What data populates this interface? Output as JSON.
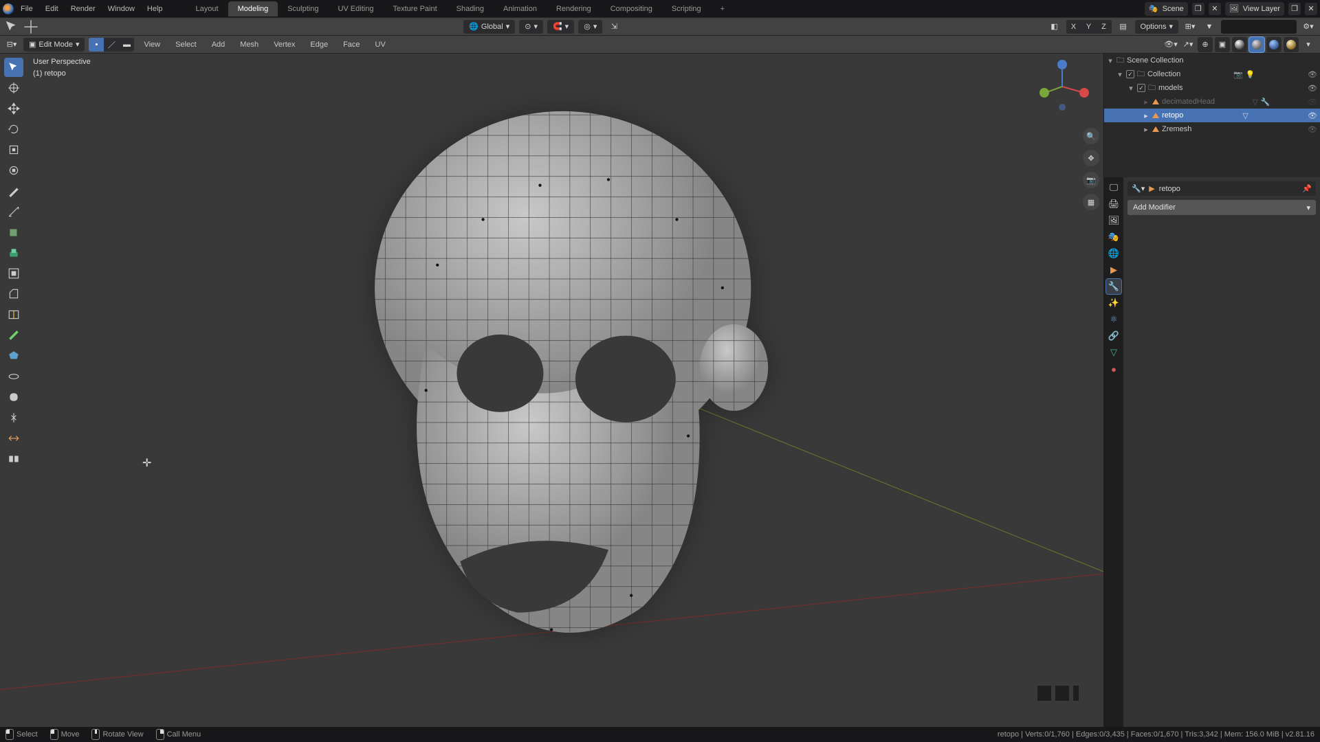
{
  "menu": {
    "file": "File",
    "edit": "Edit",
    "render": "Render",
    "window": "Window",
    "help": "Help"
  },
  "workspace_tabs": [
    "Layout",
    "Modeling",
    "Sculpting",
    "UV Editing",
    "Texture Paint",
    "Shading",
    "Animation",
    "Rendering",
    "Compositing",
    "Scripting"
  ],
  "workspace_active": 1,
  "scene_label": "Scene",
  "viewlayer_label": "View Layer",
  "sec": {
    "transform_orientation": "Global",
    "options": "Options"
  },
  "axes": [
    "X",
    "Y",
    "Z"
  ],
  "vp": {
    "mode": "Edit Mode",
    "menus": [
      "View",
      "Select",
      "Add",
      "Mesh",
      "Vertex",
      "Edge",
      "Face",
      "UV"
    ],
    "overlay_line1": "User Perspective",
    "overlay_line2": "(1) retopo"
  },
  "outliner": {
    "root": "Scene Collection",
    "collection": "Collection",
    "models": "models",
    "items": [
      {
        "name": "decimatedHead",
        "dim": true
      },
      {
        "name": "retopo",
        "sel": true
      },
      {
        "name": "Zremesh",
        "dim": false
      }
    ]
  },
  "props": {
    "crumb_obj": "retopo",
    "add_modifier": "Add Modifier"
  },
  "status": {
    "select": "Select",
    "move": "Move",
    "rotate_view": "Rotate View",
    "call_menu": "Call Menu",
    "stats": "retopo | Verts:0/1,760 | Edges:0/3,435 | Faces:0/1,670 | Tris:3,342 | Mem: 156.0 MiB | v2.81.16"
  },
  "search_placeholder": ""
}
